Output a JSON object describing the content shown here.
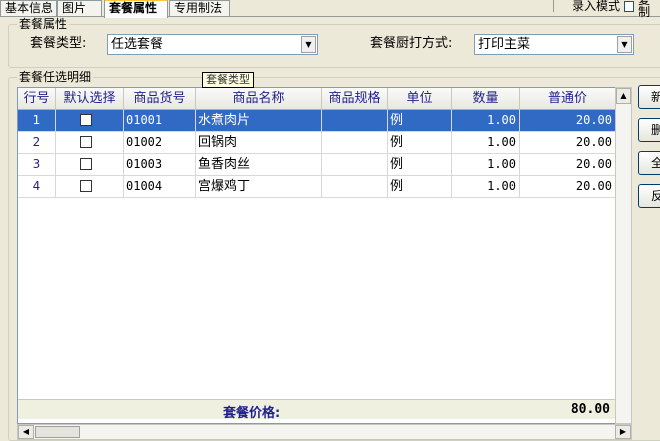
{
  "tabs": [
    {
      "label": "基本信息",
      "active": false
    },
    {
      "label": "图片",
      "active": false
    },
    {
      "label": "套餐属性",
      "active": true
    },
    {
      "label": "专用制法",
      "active": false
    }
  ],
  "top_right": {
    "entry_mode_label": "录入模式",
    "second_check_label": "复制"
  },
  "group_props": {
    "title": "套餐属性",
    "type_label": "套餐类型:",
    "type_value": "任选套餐",
    "kitchen_label": "套餐厨打方式:",
    "kitchen_value": "打印主菜"
  },
  "tooltip": "套餐类型",
  "group_detail": {
    "title": "套餐任选明细"
  },
  "grid": {
    "columns": [
      "行号",
      "默认选择",
      "商品货号",
      "商品名称",
      "商品规格",
      "单位",
      "数量",
      "普通价"
    ],
    "rows": [
      {
        "no": "1",
        "default": false,
        "code": "01001",
        "name": "水煮肉片",
        "spec": "",
        "unit": "例",
        "qty": "1.00",
        "price": "20.00",
        "selected": true
      },
      {
        "no": "2",
        "default": false,
        "code": "01002",
        "name": "回锅肉",
        "spec": "",
        "unit": "例",
        "qty": "1.00",
        "price": "20.00",
        "selected": false
      },
      {
        "no": "3",
        "default": false,
        "code": "01003",
        "name": "鱼香肉丝",
        "spec": "",
        "unit": "例",
        "qty": "1.00",
        "price": "20.00",
        "selected": false
      },
      {
        "no": "4",
        "default": false,
        "code": "01004",
        "name": "宫爆鸡丁",
        "spec": "",
        "unit": "例",
        "qty": "1.00",
        "price": "20.00",
        "selected": false
      }
    ],
    "footer_label": "套餐价格:",
    "footer_value": "80.00"
  },
  "side_buttons": [
    "新",
    "删",
    "全",
    "反"
  ],
  "colors": {
    "selected_row": "#316ac5",
    "header_text": "#1f1f8f",
    "tab_active_accent": "#ffc83c"
  }
}
